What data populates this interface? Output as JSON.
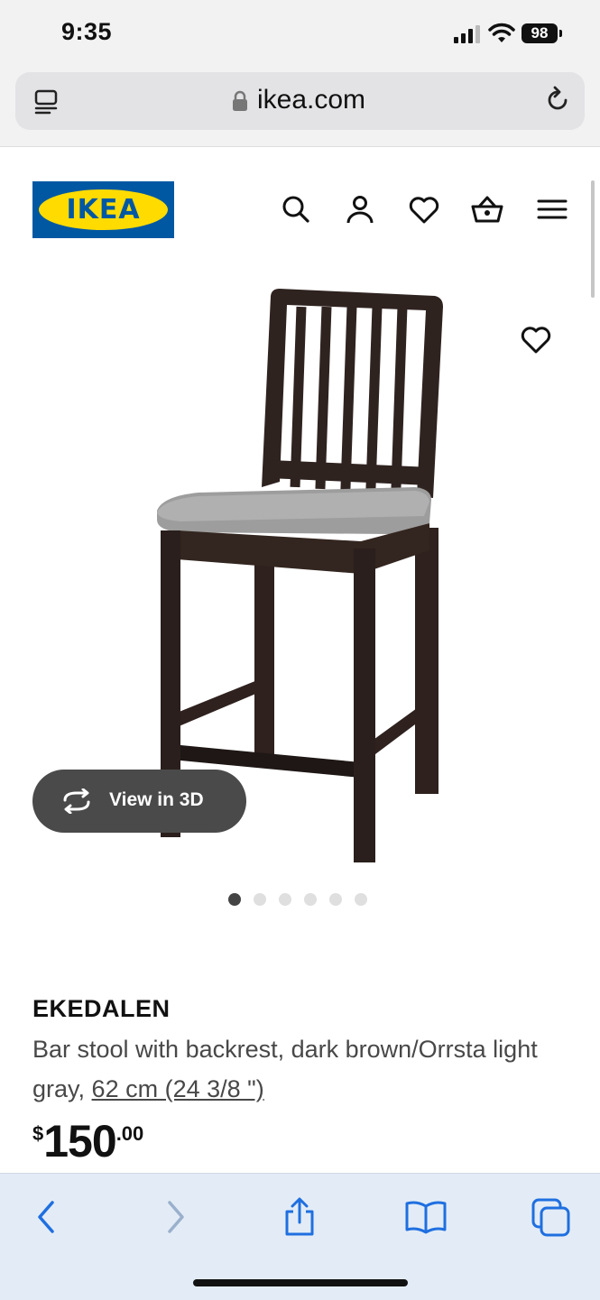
{
  "status_bar": {
    "time": "9:35",
    "battery": "98"
  },
  "browser": {
    "url": "ikea.com"
  },
  "brand": {
    "logo_text": "IKEA",
    "blue": "#0058a3",
    "yellow": "#ffdb00"
  },
  "header_icons": [
    "search-icon",
    "account-icon",
    "wishlist-icon",
    "cart-icon",
    "menu-icon"
  ],
  "gallery": {
    "view_3d_label": "View in 3D",
    "image_count": 6,
    "active_index": 0
  },
  "product": {
    "name": "EKEDALEN",
    "description": "Bar stool with backrest, dark brown/Orrsta light gray,",
    "size_link": "62 cm (24 3/8 \")",
    "price": {
      "currency": "$",
      "integer": "150",
      "decimals": ".00"
    }
  },
  "toolbar_icons": [
    "back-icon",
    "forward-icon",
    "share-icon",
    "bookmarks-icon",
    "tabs-icon"
  ]
}
